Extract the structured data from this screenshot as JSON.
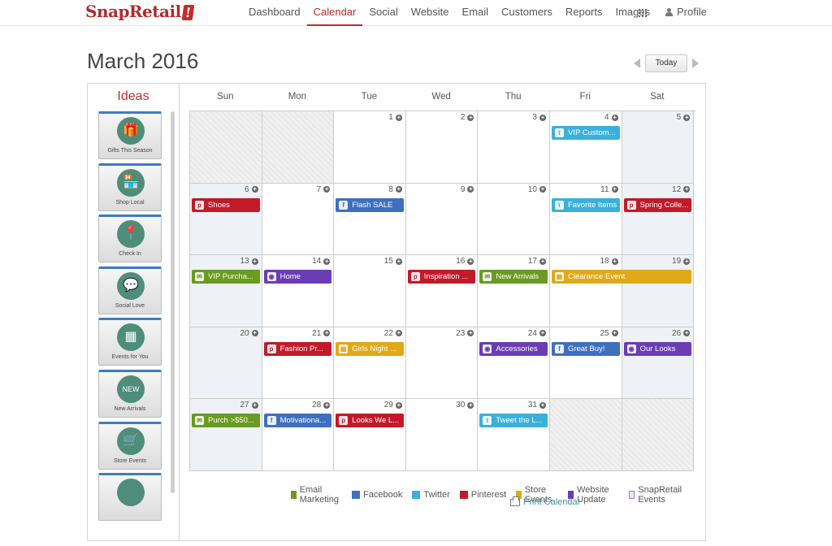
{
  "brand": {
    "name": "SnapRetail",
    "mark": "!"
  },
  "nav": {
    "items": [
      "Dashboard",
      "Calendar",
      "Social",
      "Website",
      "Email",
      "Customers",
      "Reports",
      "Images"
    ],
    "active_index": 1,
    "apps_icon": "apps-grid-icon",
    "profile_label": "Profile"
  },
  "header": {
    "month_title": "March 2016",
    "today_label": "Today"
  },
  "ideas": {
    "title": "Ideas",
    "items": [
      {
        "label": "Gifts This Season",
        "icon": "gift-icon",
        "glyph": "🎁"
      },
      {
        "label": "Shop Local",
        "icon": "storefront-icon",
        "glyph": "🏪"
      },
      {
        "label": "Check In",
        "icon": "map-pin-icon",
        "glyph": "📍"
      },
      {
        "label": "Social Love",
        "icon": "social-chat-icon",
        "glyph": "💬"
      },
      {
        "label": "Events for You",
        "icon": "calendar-icon",
        "glyph": "▦"
      },
      {
        "label": "New Arrivals",
        "icon": "new-badge-icon",
        "glyph": "NEW"
      },
      {
        "label": "Store Events",
        "icon": "cart-icon",
        "glyph": "🛒"
      },
      {
        "label": "",
        "icon": "idea-icon",
        "glyph": ""
      }
    ]
  },
  "calendar": {
    "weekdays": [
      "Sun",
      "Mon",
      "Tue",
      "Wed",
      "Thu",
      "Fri",
      "Sat"
    ],
    "weeks": [
      [
        null,
        null,
        {
          "d": "1"
        },
        {
          "d": "2"
        },
        {
          "d": "3"
        },
        {
          "d": "4",
          "events": [
            {
              "title": "VIP Custom...",
              "type": "twitter"
            }
          ]
        },
        {
          "d": "5"
        }
      ],
      [
        {
          "d": "6",
          "events": [
            {
              "title": "Shoes",
              "type": "pinterest"
            }
          ]
        },
        {
          "d": "7"
        },
        {
          "d": "8",
          "events": [
            {
              "title": "Flash SALE",
              "type": "facebook"
            }
          ]
        },
        {
          "d": "9"
        },
        {
          "d": "10"
        },
        {
          "d": "11",
          "events": [
            {
              "title": "Favorite Items",
              "type": "twitter"
            }
          ]
        },
        {
          "d": "12",
          "events": [
            {
              "title": "Spring Colle...",
              "type": "pinterest"
            }
          ]
        }
      ],
      [
        {
          "d": "13",
          "events": [
            {
              "title": "VIP Purcha...",
              "type": "email"
            }
          ]
        },
        {
          "d": "14",
          "events": [
            {
              "title": "Home",
              "type": "website"
            }
          ]
        },
        {
          "d": "15"
        },
        {
          "d": "16",
          "events": [
            {
              "title": "Inspiration ...",
              "type": "pinterest"
            }
          ]
        },
        {
          "d": "17",
          "events": [
            {
              "title": "New Arrivals",
              "type": "email"
            }
          ]
        },
        {
          "d": "18",
          "events": [
            {
              "title": "Clearance Event",
              "type": "store",
              "span": 2
            }
          ]
        },
        {
          "d": "19"
        }
      ],
      [
        {
          "d": "20"
        },
        {
          "d": "21",
          "events": [
            {
              "title": "Fashion Pr...",
              "type": "pinterest"
            }
          ]
        },
        {
          "d": "22",
          "events": [
            {
              "title": "Girls Night ...",
              "type": "store"
            }
          ]
        },
        {
          "d": "23"
        },
        {
          "d": "24",
          "events": [
            {
              "title": "Accessories",
              "type": "website"
            }
          ]
        },
        {
          "d": "25",
          "events": [
            {
              "title": "Great Buy!",
              "type": "facebook"
            }
          ]
        },
        {
          "d": "26",
          "events": [
            {
              "title": "Our Looks",
              "type": "website"
            }
          ]
        }
      ],
      [
        {
          "d": "27",
          "events": [
            {
              "title": "Purch >$50...",
              "type": "email"
            }
          ]
        },
        {
          "d": "28",
          "events": [
            {
              "title": "Motivationa...",
              "type": "facebook"
            }
          ]
        },
        {
          "d": "29",
          "events": [
            {
              "title": "Looks We L...",
              "type": "pinterest"
            }
          ]
        },
        {
          "d": "30"
        },
        {
          "d": "31",
          "events": [
            {
              "title": "Tweet the L...",
              "type": "twitter"
            }
          ]
        },
        null,
        null
      ]
    ]
  },
  "event_types": {
    "email": {
      "color": "#6a9a1f",
      "glyph": "✉"
    },
    "facebook": {
      "color": "#3f6fbf",
      "glyph": "f"
    },
    "twitter": {
      "color": "#3bb0dd",
      "glyph": "t"
    },
    "pinterest": {
      "color": "#c21a2a",
      "glyph": "p"
    },
    "store": {
      "color": "#e0a91a",
      "glyph": "▦"
    },
    "website": {
      "color": "#6a3db5",
      "glyph": "◉"
    }
  },
  "legend": [
    {
      "label": "Email Marketing",
      "color": "#6a9a1f"
    },
    {
      "label": "Facebook",
      "color": "#3f6fbf"
    },
    {
      "label": "Twitter",
      "color": "#3bb0dd"
    },
    {
      "label": "Pinterest",
      "color": "#c21a2a"
    },
    {
      "label": "Store Events",
      "color": "#e0a91a"
    },
    {
      "label": "Website Update",
      "color": "#6a3db5"
    },
    {
      "label": "SnapRetail Events",
      "color": "#efe7f7"
    }
  ],
  "print_label": "Print Calendar"
}
